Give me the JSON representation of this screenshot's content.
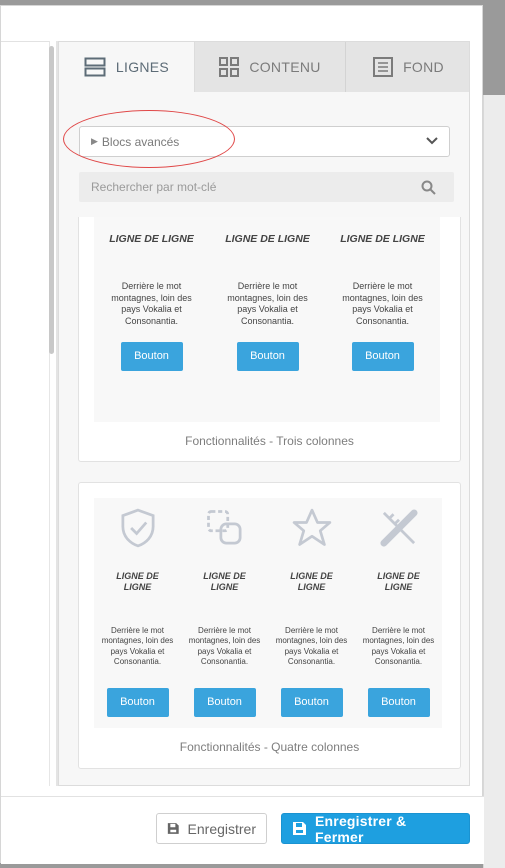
{
  "panel": {
    "tabs": [
      {
        "label": "LIGNES",
        "icon": "rows-icon",
        "active": true
      },
      {
        "label": "CONTENU",
        "icon": "grid-icon",
        "active": false
      },
      {
        "label": "FOND",
        "icon": "background-icon",
        "active": false
      }
    ],
    "category_select": {
      "value": "Blocs avancés"
    },
    "search": {
      "placeholder": "Rechercher par mot-clé"
    }
  },
  "blocks": [
    {
      "caption": "Fonctionnalités - Trois colonnes",
      "columns": [
        {
          "icon": "shield-check-icon",
          "heading": "LIGNE DE LIGNE",
          "text": "Derrière le mot montagnes, loin des pays Vokalia et Consonantia.",
          "button": "Bouton"
        },
        {
          "icon": "puzzle-icon",
          "heading": "LIGNE DE LIGNE",
          "text": "Derrière le mot montagnes, loin des pays Vokalia et Consonantia.",
          "button": "Bouton"
        },
        {
          "icon": "pencil-ruler-icon",
          "heading": "LIGNE DE LIGNE",
          "text": "Derrière le mot montagnes, loin des pays Vokalia et Consonantia.",
          "button": "Bouton"
        }
      ]
    },
    {
      "caption": "Fonctionnalités - Quatre colonnes",
      "columns": [
        {
          "icon": "shield-check-icon",
          "heading": "LIGNE DE LIGNE",
          "text": "Derrière le mot montagnes, loin des pays Vokalia et Consonantia.",
          "button": "Bouton"
        },
        {
          "icon": "shapes-icon",
          "heading": "LIGNE DE LIGNE",
          "text": "Derrière le mot montagnes, loin des pays Vokalia et Consonantia.",
          "button": "Bouton"
        },
        {
          "icon": "star-icon",
          "heading": "LIGNE DE LIGNE",
          "text": "Derrière le mot montagnes, loin des pays Vokalia et Consonantia.",
          "button": "Bouton"
        },
        {
          "icon": "pencil-ruler-icon",
          "heading": "LIGNE DE LIGNE",
          "text": "Derrière le mot montagnes, loin des pays Vokalia et Consonantia.",
          "button": "Bouton"
        }
      ]
    }
  ],
  "footer": {
    "save_label": "Enregistrer",
    "save_close_label": "Enregistrer & Fermer"
  },
  "colors": {
    "accent": "#1e9fe0",
    "block_button": "#3aa4dd",
    "annotation": "#e04848"
  }
}
